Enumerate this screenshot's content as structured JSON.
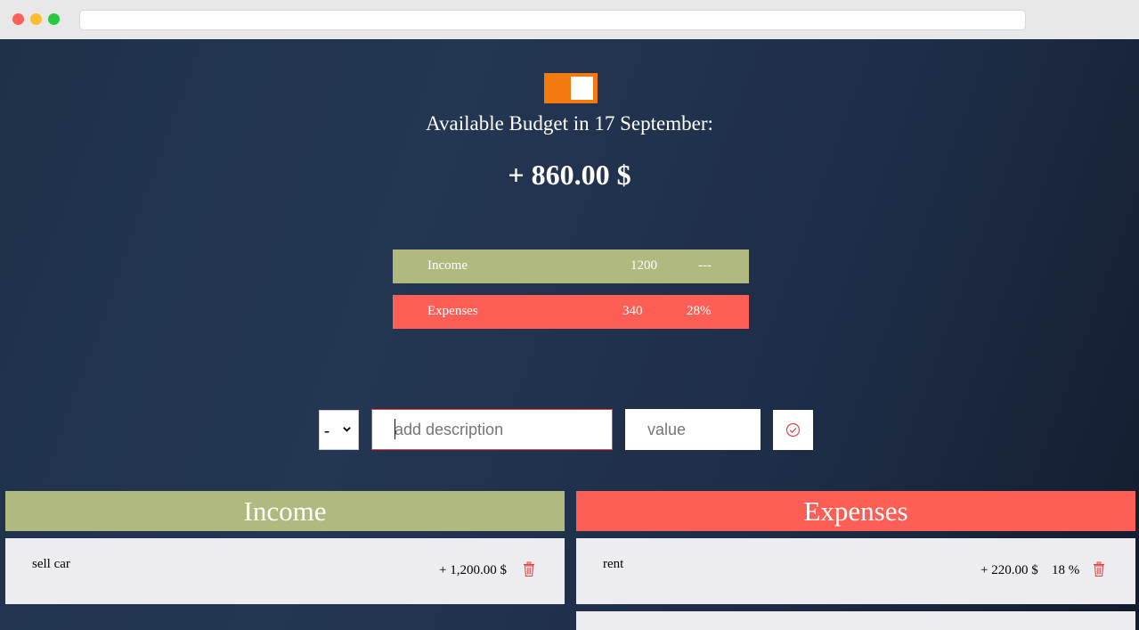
{
  "budget": {
    "title": "Available Budget in 17 September:",
    "value": "+ 860.00 $"
  },
  "summary": {
    "income": {
      "label": "Income",
      "value": "1200",
      "percentage": "---"
    },
    "expenses": {
      "label": "Expenses",
      "value": "340",
      "percentage": "28%"
    }
  },
  "add_form": {
    "type_selected": "-",
    "description_placeholder": "add description",
    "value_placeholder": "value"
  },
  "income_list": {
    "title": "Income",
    "items": [
      {
        "description": "sell car",
        "amount": "+ 1,200.00 $"
      }
    ]
  },
  "expenses_list": {
    "title": "Expenses",
    "items": [
      {
        "description": "rent",
        "amount": "+ 220.00 $",
        "percentage": "18 %"
      }
    ]
  },
  "colors": {
    "income": "#b0ba7e",
    "expenses": "#fd5f56",
    "toggle": "#f47a0f",
    "background": "#233652"
  },
  "icons": {
    "add": "check-circle-icon",
    "delete": "trash-icon",
    "select": "chevron-down-icon"
  }
}
